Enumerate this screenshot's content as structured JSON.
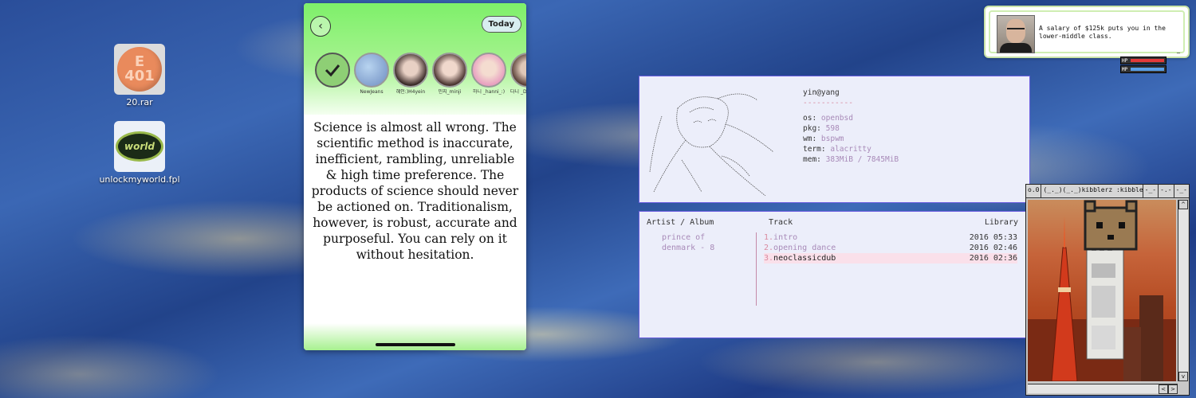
{
  "desktop": {
    "icons": [
      {
        "label": "20.rar",
        "icon": "pill-icon",
        "pill_text_top": "E",
        "pill_text_bottom": "401"
      },
      {
        "label": "unlockmyworld.fpl",
        "icon": "world-badge-icon",
        "badge_text": "world"
      }
    ]
  },
  "phone": {
    "back_icon": "chevron-left-icon",
    "today_label": "Today",
    "stories": [
      {
        "caption": ""
      },
      {
        "caption": "NewJeans"
      },
      {
        "caption": "혜인:)H4yein"
      },
      {
        "caption": "민지_minji"
      },
      {
        "caption": "하니 _hanni_:)"
      },
      {
        "caption": "다니 _Dan"
      }
    ],
    "quote": "Science is almost all wrong. The scientific method is inaccurate, inefficient, rambling, unreliable & high time preference. The products of science should never be actioned on. Traditionalism, however, is robust, accurate and purposeful. You can rely on it without hesitation."
  },
  "fetch": {
    "title": "yin@yang",
    "separator": "-----------",
    "rows": [
      {
        "key": "os:",
        "value": "openbsd"
      },
      {
        "key": "pkg:",
        "value": "598"
      },
      {
        "key": "wm:",
        "value": "bspwm"
      },
      {
        "key": "term:",
        "value": "alacritty"
      },
      {
        "key": "mem:",
        "value": "383MiB / 7845MiB"
      }
    ]
  },
  "music": {
    "headers": {
      "artist": "Artist / Album",
      "track": "Track",
      "library": "Library"
    },
    "artist_line1": "prince of",
    "artist_line2": "denmark - 8",
    "tracks": [
      {
        "num": "1.",
        "title": "intro",
        "year": "2016",
        "time": "05:33",
        "selected": false
      },
      {
        "num": "2.",
        "title": "opening dance",
        "year": "2016",
        "time": "02:46",
        "selected": false
      },
      {
        "num": "3.",
        "title": "neoclassicdub",
        "year": "2016",
        "time": "02:36",
        "selected": true
      }
    ]
  },
  "bubble": {
    "text": "A salary of $125k puts you in the lower-middle class.",
    "cursor": "_",
    "hp_label": "HP",
    "mp_label": "MP",
    "hp_color": "#e23a3a",
    "mp_color": "#5aa0e8",
    "hp_fraction": 0.95,
    "mp_fraction": 0.95
  },
  "retro": {
    "tabs": [
      "o.0",
      "(_._)(_._)kibblerz :kibble:",
      "-_-",
      "-.-",
      "-_-"
    ],
    "scroll_up": "^",
    "scroll_down": "v",
    "scroll_left": "<",
    "scroll_right": ">"
  }
}
